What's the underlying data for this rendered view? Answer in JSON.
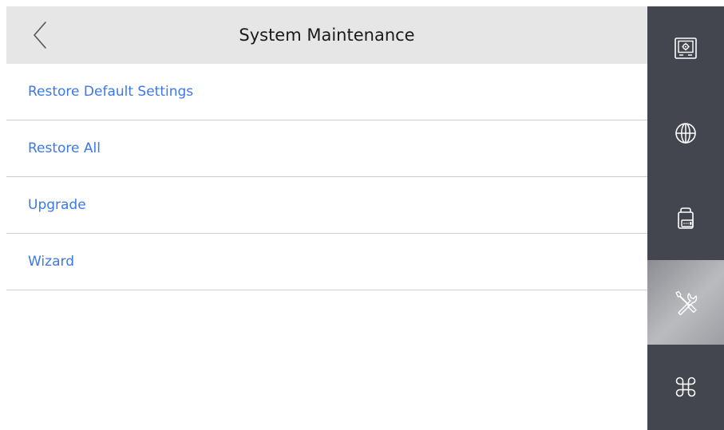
{
  "header": {
    "title": "System Maintenance",
    "back_icon": "chevron-left-icon"
  },
  "menu": {
    "items": [
      {
        "label": "Restore Default Settings"
      },
      {
        "label": "Restore All"
      },
      {
        "label": "Upgrade"
      },
      {
        "label": "Wizard"
      }
    ]
  },
  "sidebar": {
    "items": [
      {
        "icon": "device-settings-icon",
        "active": false
      },
      {
        "icon": "globe-icon",
        "active": false
      },
      {
        "icon": "device-terminal-icon",
        "active": false
      },
      {
        "icon": "tools-icon",
        "active": true
      },
      {
        "icon": "command-icon",
        "active": false
      }
    ]
  },
  "colors": {
    "header_bg": "#e6e6e6",
    "link_blue": "#3c78e8",
    "sidebar_bg": "#43464e",
    "divider": "#cfcfcf"
  }
}
